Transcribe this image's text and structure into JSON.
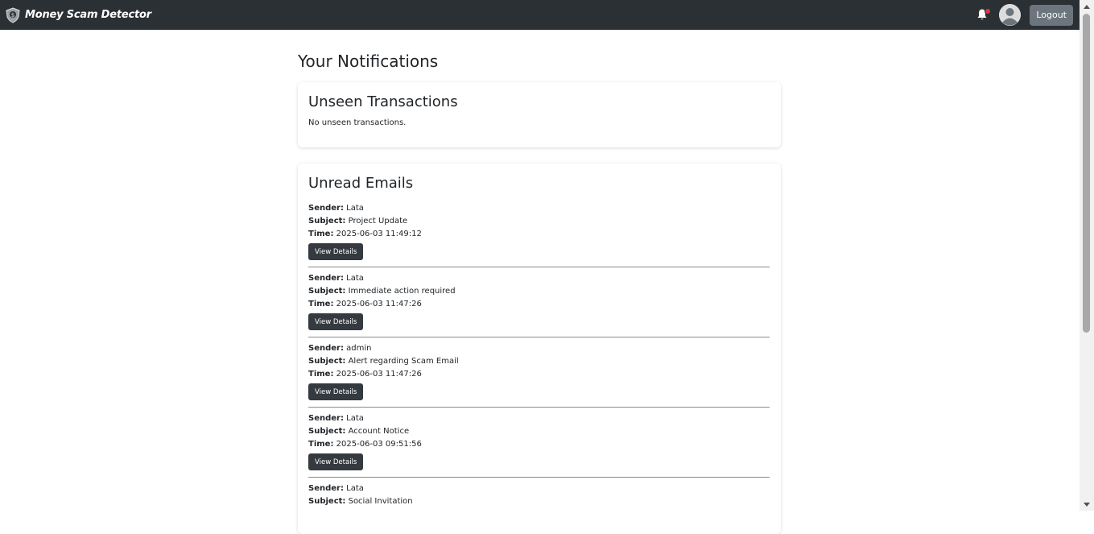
{
  "navbar": {
    "brand_title": "Money Scam Detector",
    "logout_label": "Logout",
    "bg_color": "#2b3035",
    "notification_dot_color": "#dc3545"
  },
  "main": {
    "page_title": "Your Notifications",
    "transactions": {
      "title": "Unseen Transactions",
      "empty_text": "No unseen transactions."
    },
    "emails": {
      "title": "Unread Emails",
      "labels": {
        "sender": "Sender:",
        "subject": "Subject:",
        "time": "Time:"
      },
      "button_label": "View Details",
      "items": [
        {
          "sender": "Lata",
          "subject": "Project Update",
          "time": "2025-06-03 11:49:12"
        },
        {
          "sender": "Lata",
          "subject": "Immediate action required",
          "time": "2025-06-03 11:47:26"
        },
        {
          "sender": "admin",
          "subject": "Alert regarding Scam Email",
          "time": "2025-06-03 11:47:26"
        },
        {
          "sender": "Lata",
          "subject": "Account Notice",
          "time": "2025-06-03 09:51:56"
        },
        {
          "sender": "Lata",
          "subject": "Social Invitation",
          "time": ""
        }
      ]
    }
  }
}
